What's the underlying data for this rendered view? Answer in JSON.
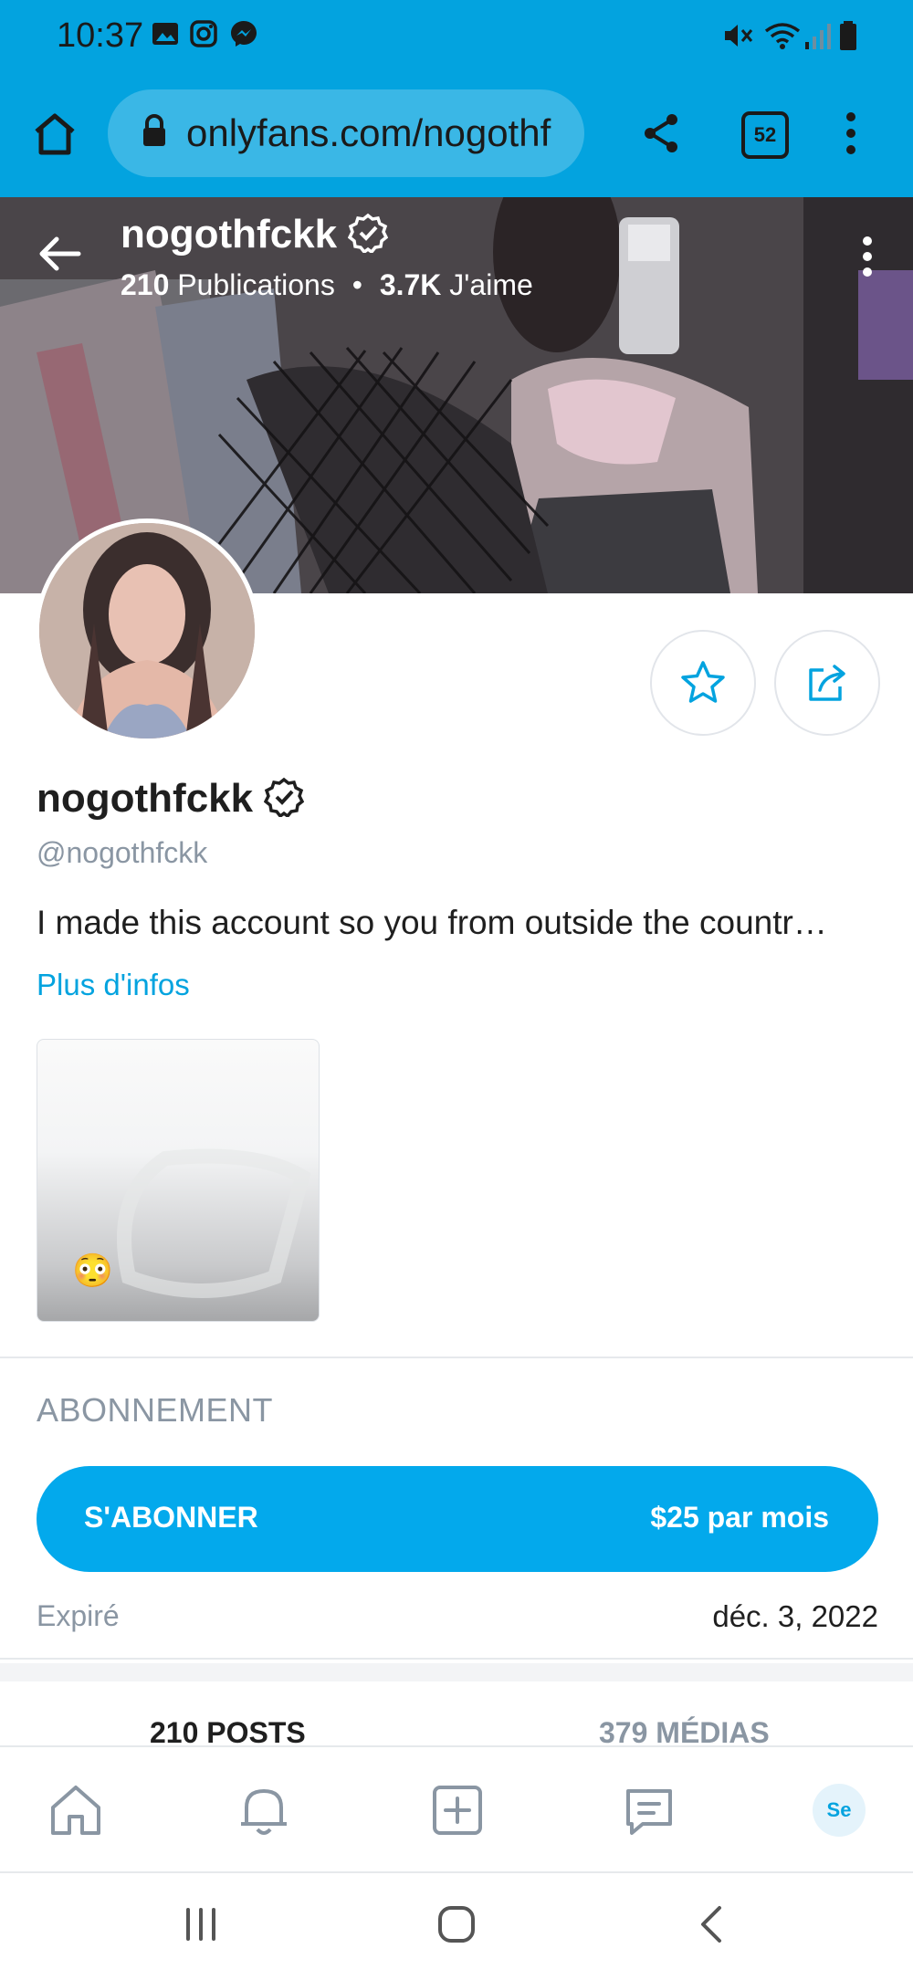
{
  "status_bar": {
    "time": "10:37",
    "left_icons": [
      "gallery-icon",
      "instagram-icon",
      "messenger-icon"
    ],
    "right_icons": [
      "mute-icon",
      "wifi-icon",
      "signal-icon",
      "battery-icon"
    ]
  },
  "browser": {
    "url": "onlyfans.com/nogothf",
    "tab_count": "52",
    "accent_color": "#03a3df"
  },
  "profile": {
    "cover_name": "nogothfckk",
    "posts_count": "210",
    "posts_label": "Publications",
    "likes_count": "3.7K",
    "likes_label": "J'aime",
    "name": "nogothfckk",
    "handle": "@nogothfckk",
    "bio": "I made this account so you from outside the countr…",
    "more_info": "Plus d'infos",
    "media_emoji": "😳"
  },
  "subscription": {
    "heading": "ABONNEMENT",
    "button_label": "S'ABONNER",
    "price": "$25 par mois",
    "expired_label": "Expiré",
    "expired_date": "déc. 3, 2022"
  },
  "tabs": [
    {
      "label": "210 POSTS"
    },
    {
      "label": "379 MÉDIAS"
    }
  ],
  "bottom_nav": {
    "avatar_initials": "Se"
  }
}
